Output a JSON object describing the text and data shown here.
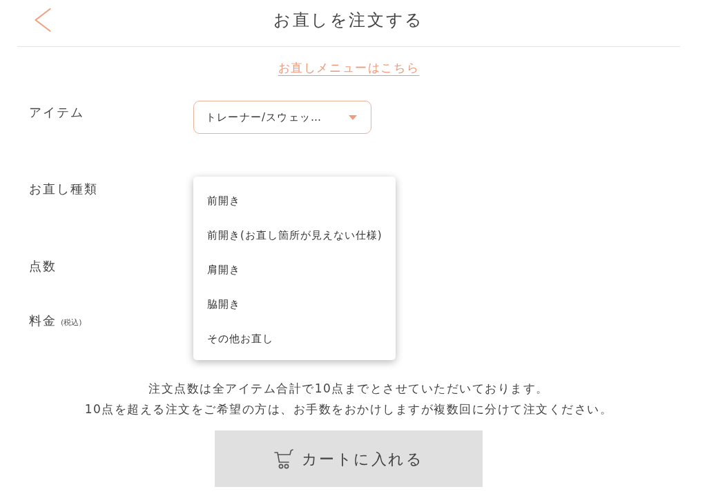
{
  "header": {
    "title": "お直しを注文する"
  },
  "menu_link": {
    "label": "お直しメニューはこちら"
  },
  "fields": [
    {
      "label": "アイテム",
      "value": "トレーナー/スウェッ…"
    },
    {
      "label": "お直し種類",
      "options": [
        {
          "label": "前開き",
          "selected": false
        },
        {
          "label": "前開き(お直し箇所が見えない仕様)",
          "selected": false
        },
        {
          "label": "肩開き",
          "selected": false
        },
        {
          "label": "脇開き",
          "selected": false
        },
        {
          "label": "その他お直し",
          "selected": false
        }
      ]
    },
    {
      "label": "点数"
    },
    {
      "label": "料金",
      "note": "(税込)"
    }
  ],
  "notice": [
    "注文点数は全アイテム合計で10点までとさせていただいております。",
    "10点を超える注文をご希望の方は、お手数をおかけしますが複数回に分けて注文ください。"
  ],
  "cart_button": {
    "label": "カートに入れる"
  }
}
